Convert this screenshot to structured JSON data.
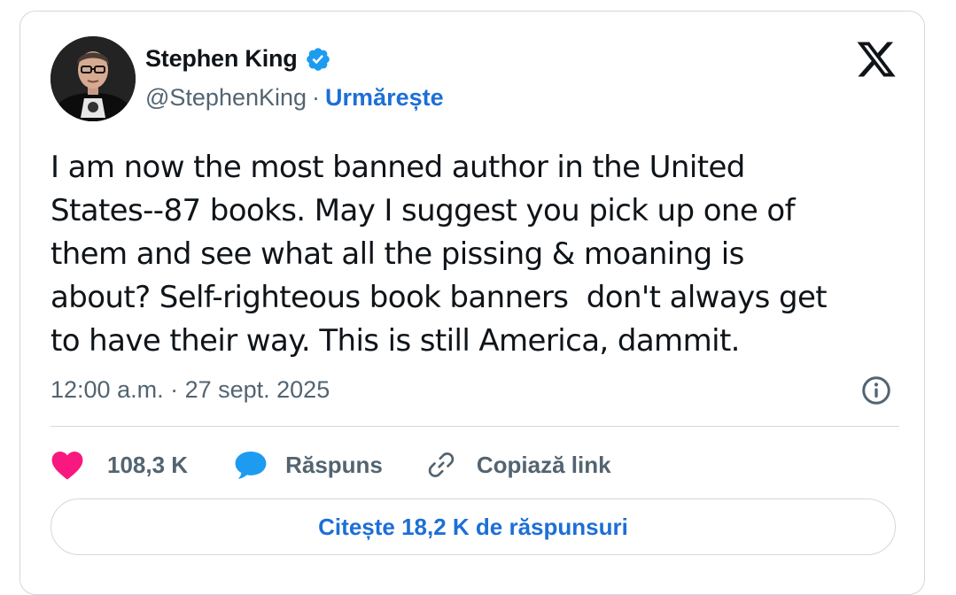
{
  "author": {
    "display_name": "Stephen King",
    "handle": "@StephenKing",
    "separator": "·",
    "follow_label": "Urmărește",
    "verified": true,
    "verified_color": "#1d9bf0",
    "avatar_icon": "author-photo"
  },
  "platform": {
    "logo_icon": "x-logo-icon"
  },
  "tweet": {
    "text": "I am now the most banned author in the United\nStates--87 books. May I suggest you pick up one of\nthem and see what all the pissing & moaning is\nabout? Self-righteous book banners  don't always get\nto have their way. This is still America, dammit.",
    "timestamp": "12:00 a.m. · 27 sept. 2025"
  },
  "actions": {
    "like": {
      "count": "108,3 K",
      "icon": "heart-icon",
      "color": "#f91880"
    },
    "reply": {
      "label": "Răspuns",
      "icon": "speech-bubble-icon",
      "color": "#1d9bf0"
    },
    "copy": {
      "label": "Copiază link",
      "icon": "link-icon"
    }
  },
  "footer": {
    "read_replies_label": "Citește 18,2 K de răspunsuri"
  },
  "colors": {
    "accent": "#1d6fd6",
    "text": "#0f1419",
    "muted": "#536471",
    "border": "#cfd9de"
  }
}
